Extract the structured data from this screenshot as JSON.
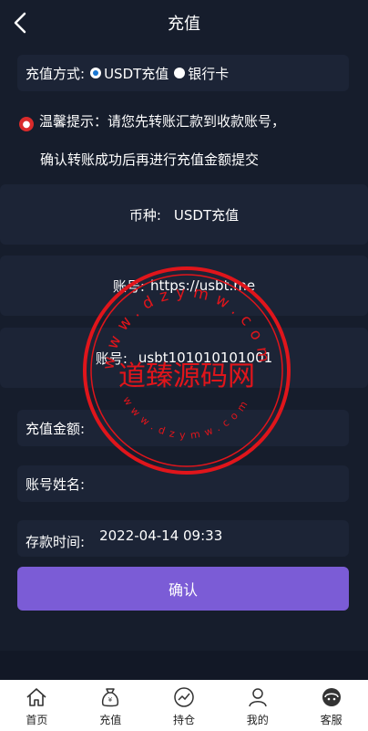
{
  "header": {
    "title": "充值"
  },
  "method": {
    "label": "充值方式:",
    "options": [
      {
        "label": "USDT充值",
        "selected": true
      },
      {
        "label": "银行卡",
        "selected": false
      }
    ]
  },
  "tip": {
    "line1": "温馨提示：请您先转账汇款到收款账号，",
    "line2": "确认转账成功后再进行充值金额提交"
  },
  "currency": {
    "label": "币种:",
    "value": "USDT充值"
  },
  "account_url": {
    "label": "账号:",
    "value": "https://usbt.me"
  },
  "account_no": {
    "label": "账号:",
    "value": "usbt101010101001"
  },
  "form": {
    "amount_label": "充值金额:",
    "name_label": "账号姓名:",
    "time_label": "存款时间:",
    "time_value": "2022-04-14 09:33"
  },
  "confirm_label": "确认",
  "watermark": {
    "text": "道臻源码网",
    "ring_top": "www.dzymw.com",
    "ring_bottom": "www.dzymw.com",
    "color": "#e0151b"
  },
  "tabs": [
    {
      "label": "首页",
      "icon": "home-icon"
    },
    {
      "label": "充值",
      "icon": "money-bag-icon"
    },
    {
      "label": "持仓",
      "icon": "chart-icon"
    },
    {
      "label": "我的",
      "icon": "user-icon"
    },
    {
      "label": "客服",
      "icon": "support-icon"
    }
  ]
}
